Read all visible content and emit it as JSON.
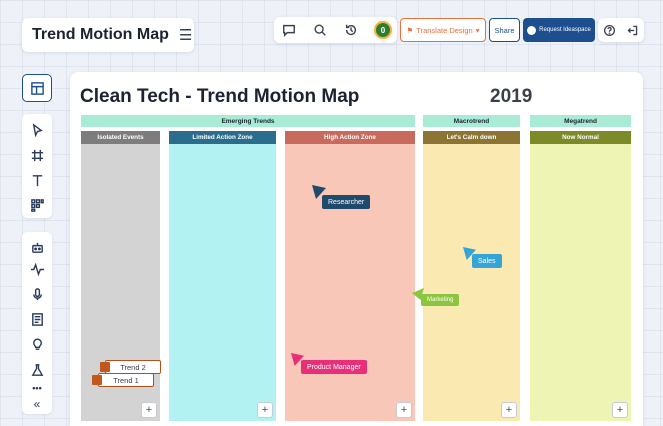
{
  "app": {
    "title": "Trend Motion Map"
  },
  "toolbar": {
    "translate_label": "Translate Design",
    "share_label": "Share",
    "request_label": "Request Ideaspace",
    "user_initial": "0",
    "icons": [
      "comment-icon",
      "search-icon",
      "history-icon",
      "download-icon",
      "help-icon",
      "exit-icon"
    ]
  },
  "rail": {
    "icons": [
      "layout-icon",
      "pointer-icon",
      "frame-icon",
      "text-icon",
      "grid-icon",
      "robot-icon",
      "pulse-icon",
      "microphone-icon",
      "document-icon",
      "lightbulb-icon",
      "flask-icon",
      "more-icon",
      "collapse-icon"
    ],
    "more_label": "•••",
    "collapse_label": "«"
  },
  "map": {
    "title": "Clean Tech - Trend Motion Map",
    "year": "2019",
    "categories": [
      {
        "label": "Emerging Trends"
      },
      {
        "label": "Macrotrend"
      },
      {
        "label": "Megatrend"
      }
    ],
    "columns": [
      {
        "label": "Isolated Events",
        "head_color": "#7d7d7d",
        "body_color": "#d3d3d3"
      },
      {
        "label": "Limited Action Zone",
        "head_color": "#2b6d8c",
        "body_color": "#b3f2f2"
      },
      {
        "label": "High Action Zone",
        "head_color": "#c86a5e",
        "body_color": "#f8c7b7"
      },
      {
        "label": "Let's Calm down",
        "head_color": "#8c7435",
        "body_color": "#fbe9b2"
      },
      {
        "label": "Now Normal",
        "head_color": "#7c8a28",
        "body_color": "#eef5b4"
      }
    ],
    "add_label": "+"
  },
  "tags": [
    {
      "label": "Researcher",
      "color": "#1f4a6b"
    },
    {
      "label": "Sales",
      "color": "#35a5d8"
    },
    {
      "label": "Marketing",
      "color": "#8cc63f"
    },
    {
      "label": "Product Manager",
      "color": "#e8307a"
    }
  ],
  "trends": [
    {
      "label": "Trend 2"
    },
    {
      "label": "Trend 1"
    }
  ],
  "colors": {
    "accent": "#1d4f8f",
    "translate": "#e8703a",
    "category_header": "#a9ecd5"
  }
}
